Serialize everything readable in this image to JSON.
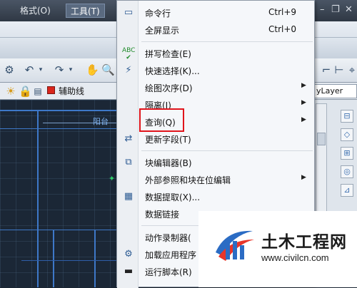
{
  "menubar": {
    "items": [
      "格式(O)",
      "工具(T)"
    ]
  },
  "toolbar": {
    "layer_label": "辅助线",
    "linetype_value": "yLayer"
  },
  "canvas": {
    "labels": [
      "阳台"
    ]
  },
  "tools_menu": {
    "items": [
      {
        "label": "命令行",
        "shortcut": "Ctrl+9",
        "icon": "command-line-icon",
        "submenu": false
      },
      {
        "label": "全屏显示",
        "shortcut": "Ctrl+0",
        "icon": "",
        "submenu": false
      },
      {
        "label": "拼写检查(E)",
        "shortcut": "",
        "icon": "spell-check-icon",
        "submenu": false
      },
      {
        "label": "快速选择(K)...",
        "shortcut": "",
        "icon": "quick-select-icon",
        "submenu": false
      },
      {
        "label": "绘图次序(D)",
        "shortcut": "",
        "icon": "",
        "submenu": true
      },
      {
        "label": "隔离(I)",
        "shortcut": "",
        "icon": "",
        "submenu": true
      },
      {
        "label": "查询(Q)",
        "shortcut": "",
        "icon": "",
        "submenu": true
      },
      {
        "label": "更新字段(T)",
        "shortcut": "",
        "icon": "update-field-icon",
        "submenu": false
      },
      {
        "label": "块编辑器(B)",
        "shortcut": "",
        "icon": "block-editor-icon",
        "submenu": false
      },
      {
        "label": "外部参照和块在位编辑",
        "shortcut": "",
        "icon": "",
        "submenu": true
      },
      {
        "label": "数据提取(X)...",
        "shortcut": "",
        "icon": "data-extraction-icon",
        "submenu": false
      },
      {
        "label": "数据链接",
        "shortcut": "",
        "icon": "",
        "submenu": false
      },
      {
        "label": "动作录制器(",
        "shortcut": "",
        "icon": "",
        "submenu": false
      },
      {
        "label": "加载应用程序",
        "shortcut": "",
        "icon": "load-app-icon",
        "submenu": false
      },
      {
        "label": "运行脚本(R)",
        "shortcut": "",
        "icon": "run-script-icon",
        "submenu": false
      }
    ]
  },
  "watermark": {
    "title": "土木工程网",
    "url": "www.civilcn.com"
  },
  "colors": {
    "highlight": "#e0141b",
    "canvas_bg": "#1b2736",
    "cad_line": "#3e78c8",
    "menu_bg": "#f5f7fa"
  }
}
